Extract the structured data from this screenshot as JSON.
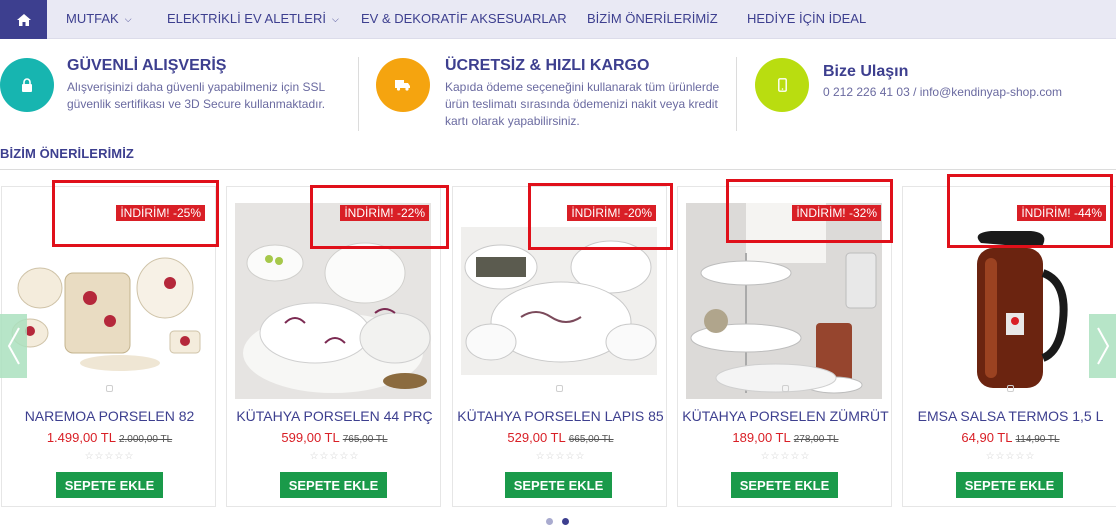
{
  "nav": {
    "items": [
      {
        "label": "MUTFAK",
        "dropdown": true
      },
      {
        "label": "ELEKTRİKLİ EV ALETLERİ",
        "dropdown": true
      },
      {
        "label": "EV & DEKORATİF AKSESUARLAR",
        "dropdown": false
      },
      {
        "label": "BİZİM ÖNERİLERİMİZ",
        "dropdown": false
      },
      {
        "label": "HEDİYE İÇİN İDEAL",
        "dropdown": false
      }
    ]
  },
  "features": [
    {
      "icon": "lock-icon",
      "color": "#17b5b0",
      "title": "GÜVENLİ ALIŞVERİŞ",
      "text": "Alışverişinizi daha güvenli yapabilmeniz için SSL güvenlik sertifikası ve 3D Secure kullanmaktadır."
    },
    {
      "icon": "truck-icon",
      "color": "#f5a40f",
      "title": "ÜCRETSİZ & HIZLI KARGO",
      "text": "Kapıda ödeme seçeneğini kullanarak tüm ürünlerde ürün teslimatı sırasında ödemenizi nakit veya kredit kartı olarak yapabilirsiniz."
    },
    {
      "icon": "phone-icon",
      "color": "#b9dd10",
      "title": "Bize Ulaşın",
      "text": "0 212 226 41 03 / info@kendinyap-shop.com"
    }
  ],
  "section": {
    "title": "BİZİM ÖNERİLERİMİZ"
  },
  "products": [
    {
      "badge": "İNDİRİM! -25%",
      "name": "NAREMOA PORSELEN 82",
      "price": "1.499,00 TL",
      "old_price": "2.000,00 TL",
      "button": "SEPETE EKLE"
    },
    {
      "badge": "İNDİRİM! -22%",
      "name": "KÜTAHYA PORSELEN 44 PRÇ",
      "price": "599,00 TL",
      "old_price": "765,00 TL",
      "button": "SEPETE EKLE"
    },
    {
      "badge": "İNDİRİM! -20%",
      "name": "KÜTAHYA PORSELEN LAPIS 85",
      "price": "529,00 TL",
      "old_price": "665,00 TL",
      "button": "SEPETE EKLE"
    },
    {
      "badge": "İNDİRİM! -32%",
      "name": "KÜTAHYA PORSELEN ZÜMRÜT",
      "price": "189,00 TL",
      "old_price": "278,00 TL",
      "button": "SEPETE EKLE"
    },
    {
      "badge": "İNDİRİM! -44%",
      "name": "EMSA SALSA TERMOS 1,5 L",
      "price": "64,90 TL",
      "old_price": "114,90 TL",
      "button": "SEPETE EKLE"
    }
  ],
  "stars": "☆☆☆☆☆",
  "colors": {
    "nav_bg": "#e9e9f4",
    "brand": "#3d3f8f",
    "sale_red": "#d91f26",
    "cart_green": "#1a9a4a"
  }
}
